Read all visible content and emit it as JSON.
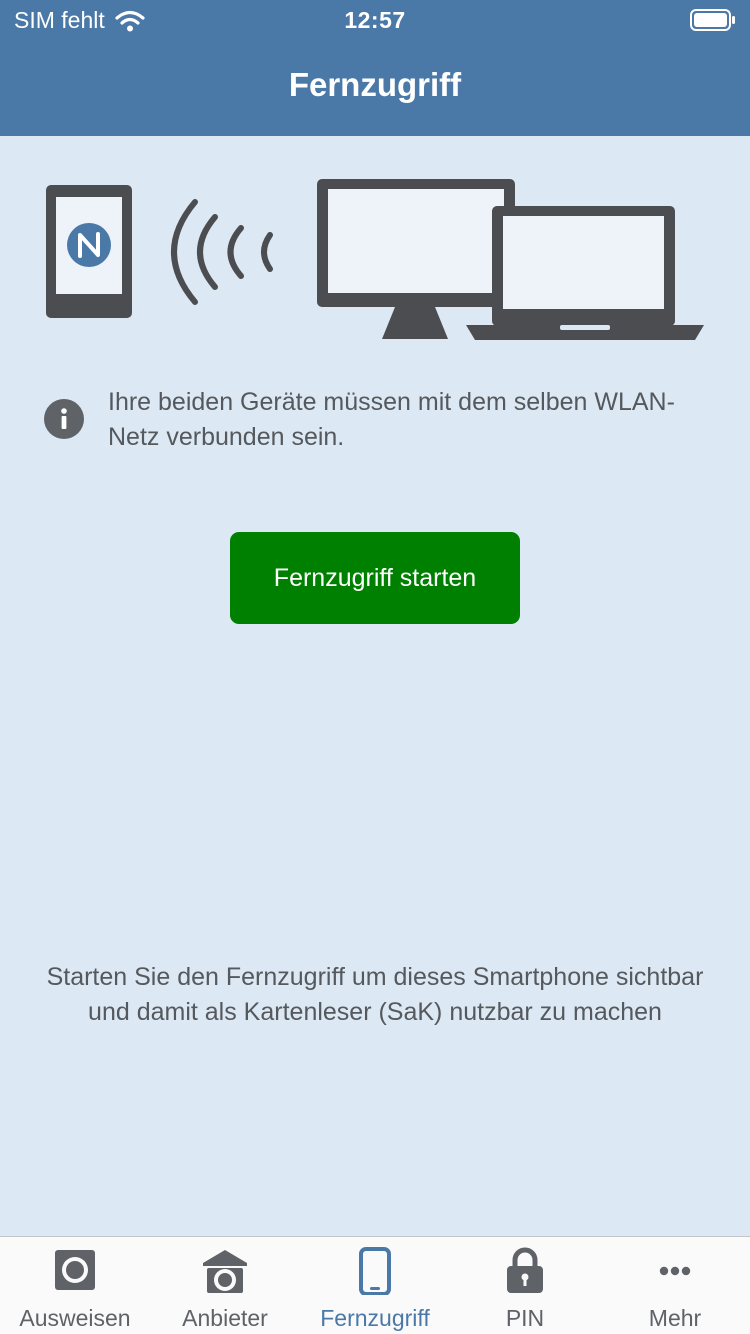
{
  "status_bar": {
    "carrier": "SIM fehlt",
    "time": "12:57"
  },
  "header": {
    "title": "Fernzugriff"
  },
  "info": {
    "message": "Ihre beiden Geräte müssen mit dem selben WLAN-Netz verbunden sein."
  },
  "actions": {
    "start_label": "Fernzugriff starten"
  },
  "hint": {
    "text": "Starten Sie den Fernzugriff um dieses Smartphone sichtbar und damit als Kartenleser (SaK) nutzbar zu machen"
  },
  "tabbar": {
    "active_index": 2,
    "items": [
      {
        "label": "Ausweisen",
        "icon": "id-card-icon"
      },
      {
        "label": "Anbieter",
        "icon": "provider-icon"
      },
      {
        "label": "Fernzugriff",
        "icon": "smartphone-icon"
      },
      {
        "label": "PIN",
        "icon": "lock-icon"
      },
      {
        "label": "Mehr",
        "icon": "more-icon"
      }
    ]
  },
  "colors": {
    "header": "#4a79a8",
    "background": "#dce9f4",
    "button": "#008000",
    "active_tab": "#4a79a8",
    "icon": "#5f6266"
  }
}
